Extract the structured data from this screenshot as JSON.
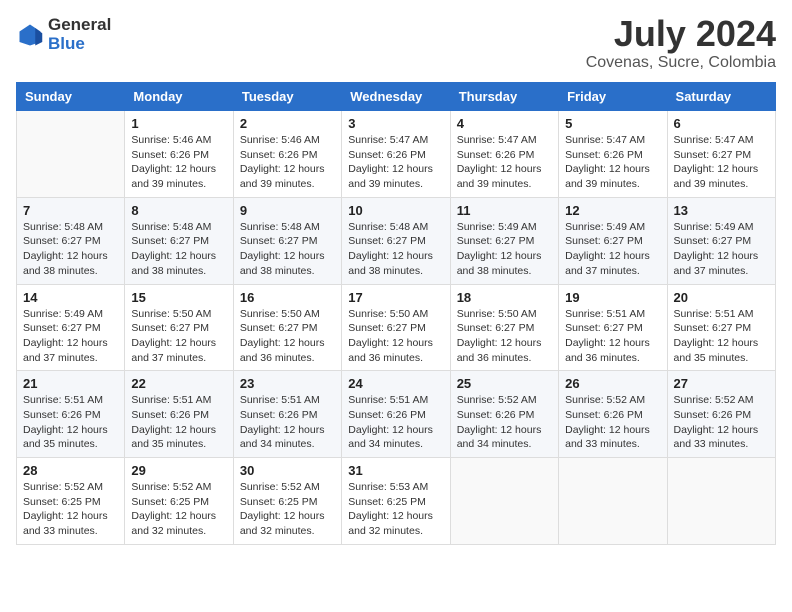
{
  "header": {
    "logo": {
      "general": "General",
      "blue": "Blue"
    },
    "title": "July 2024",
    "location": "Covenas, Sucre, Colombia"
  },
  "weekdays": [
    "Sunday",
    "Monday",
    "Tuesday",
    "Wednesday",
    "Thursday",
    "Friday",
    "Saturday"
  ],
  "weeks": [
    [
      {
        "day": "",
        "sunrise": "",
        "sunset": "",
        "daylight": ""
      },
      {
        "day": "1",
        "sunrise": "Sunrise: 5:46 AM",
        "sunset": "Sunset: 6:26 PM",
        "daylight": "Daylight: 12 hours and 39 minutes."
      },
      {
        "day": "2",
        "sunrise": "Sunrise: 5:46 AM",
        "sunset": "Sunset: 6:26 PM",
        "daylight": "Daylight: 12 hours and 39 minutes."
      },
      {
        "day": "3",
        "sunrise": "Sunrise: 5:47 AM",
        "sunset": "Sunset: 6:26 PM",
        "daylight": "Daylight: 12 hours and 39 minutes."
      },
      {
        "day": "4",
        "sunrise": "Sunrise: 5:47 AM",
        "sunset": "Sunset: 6:26 PM",
        "daylight": "Daylight: 12 hours and 39 minutes."
      },
      {
        "day": "5",
        "sunrise": "Sunrise: 5:47 AM",
        "sunset": "Sunset: 6:26 PM",
        "daylight": "Daylight: 12 hours and 39 minutes."
      },
      {
        "day": "6",
        "sunrise": "Sunrise: 5:47 AM",
        "sunset": "Sunset: 6:27 PM",
        "daylight": "Daylight: 12 hours and 39 minutes."
      }
    ],
    [
      {
        "day": "7",
        "sunrise": "Sunrise: 5:48 AM",
        "sunset": "Sunset: 6:27 PM",
        "daylight": "Daylight: 12 hours and 38 minutes."
      },
      {
        "day": "8",
        "sunrise": "Sunrise: 5:48 AM",
        "sunset": "Sunset: 6:27 PM",
        "daylight": "Daylight: 12 hours and 38 minutes."
      },
      {
        "day": "9",
        "sunrise": "Sunrise: 5:48 AM",
        "sunset": "Sunset: 6:27 PM",
        "daylight": "Daylight: 12 hours and 38 minutes."
      },
      {
        "day": "10",
        "sunrise": "Sunrise: 5:48 AM",
        "sunset": "Sunset: 6:27 PM",
        "daylight": "Daylight: 12 hours and 38 minutes."
      },
      {
        "day": "11",
        "sunrise": "Sunrise: 5:49 AM",
        "sunset": "Sunset: 6:27 PM",
        "daylight": "Daylight: 12 hours and 38 minutes."
      },
      {
        "day": "12",
        "sunrise": "Sunrise: 5:49 AM",
        "sunset": "Sunset: 6:27 PM",
        "daylight": "Daylight: 12 hours and 37 minutes."
      },
      {
        "day": "13",
        "sunrise": "Sunrise: 5:49 AM",
        "sunset": "Sunset: 6:27 PM",
        "daylight": "Daylight: 12 hours and 37 minutes."
      }
    ],
    [
      {
        "day": "14",
        "sunrise": "Sunrise: 5:49 AM",
        "sunset": "Sunset: 6:27 PM",
        "daylight": "Daylight: 12 hours and 37 minutes."
      },
      {
        "day": "15",
        "sunrise": "Sunrise: 5:50 AM",
        "sunset": "Sunset: 6:27 PM",
        "daylight": "Daylight: 12 hours and 37 minutes."
      },
      {
        "day": "16",
        "sunrise": "Sunrise: 5:50 AM",
        "sunset": "Sunset: 6:27 PM",
        "daylight": "Daylight: 12 hours and 36 minutes."
      },
      {
        "day": "17",
        "sunrise": "Sunrise: 5:50 AM",
        "sunset": "Sunset: 6:27 PM",
        "daylight": "Daylight: 12 hours and 36 minutes."
      },
      {
        "day": "18",
        "sunrise": "Sunrise: 5:50 AM",
        "sunset": "Sunset: 6:27 PM",
        "daylight": "Daylight: 12 hours and 36 minutes."
      },
      {
        "day": "19",
        "sunrise": "Sunrise: 5:51 AM",
        "sunset": "Sunset: 6:27 PM",
        "daylight": "Daylight: 12 hours and 36 minutes."
      },
      {
        "day": "20",
        "sunrise": "Sunrise: 5:51 AM",
        "sunset": "Sunset: 6:27 PM",
        "daylight": "Daylight: 12 hours and 35 minutes."
      }
    ],
    [
      {
        "day": "21",
        "sunrise": "Sunrise: 5:51 AM",
        "sunset": "Sunset: 6:26 PM",
        "daylight": "Daylight: 12 hours and 35 minutes."
      },
      {
        "day": "22",
        "sunrise": "Sunrise: 5:51 AM",
        "sunset": "Sunset: 6:26 PM",
        "daylight": "Daylight: 12 hours and 35 minutes."
      },
      {
        "day": "23",
        "sunrise": "Sunrise: 5:51 AM",
        "sunset": "Sunset: 6:26 PM",
        "daylight": "Daylight: 12 hours and 34 minutes."
      },
      {
        "day": "24",
        "sunrise": "Sunrise: 5:51 AM",
        "sunset": "Sunset: 6:26 PM",
        "daylight": "Daylight: 12 hours and 34 minutes."
      },
      {
        "day": "25",
        "sunrise": "Sunrise: 5:52 AM",
        "sunset": "Sunset: 6:26 PM",
        "daylight": "Daylight: 12 hours and 34 minutes."
      },
      {
        "day": "26",
        "sunrise": "Sunrise: 5:52 AM",
        "sunset": "Sunset: 6:26 PM",
        "daylight": "Daylight: 12 hours and 33 minutes."
      },
      {
        "day": "27",
        "sunrise": "Sunrise: 5:52 AM",
        "sunset": "Sunset: 6:26 PM",
        "daylight": "Daylight: 12 hours and 33 minutes."
      }
    ],
    [
      {
        "day": "28",
        "sunrise": "Sunrise: 5:52 AM",
        "sunset": "Sunset: 6:25 PM",
        "daylight": "Daylight: 12 hours and 33 minutes."
      },
      {
        "day": "29",
        "sunrise": "Sunrise: 5:52 AM",
        "sunset": "Sunset: 6:25 PM",
        "daylight": "Daylight: 12 hours and 32 minutes."
      },
      {
        "day": "30",
        "sunrise": "Sunrise: 5:52 AM",
        "sunset": "Sunset: 6:25 PM",
        "daylight": "Daylight: 12 hours and 32 minutes."
      },
      {
        "day": "31",
        "sunrise": "Sunrise: 5:53 AM",
        "sunset": "Sunset: 6:25 PM",
        "daylight": "Daylight: 12 hours and 32 minutes."
      },
      {
        "day": "",
        "sunrise": "",
        "sunset": "",
        "daylight": ""
      },
      {
        "day": "",
        "sunrise": "",
        "sunset": "",
        "daylight": ""
      },
      {
        "day": "",
        "sunrise": "",
        "sunset": "",
        "daylight": ""
      }
    ]
  ]
}
